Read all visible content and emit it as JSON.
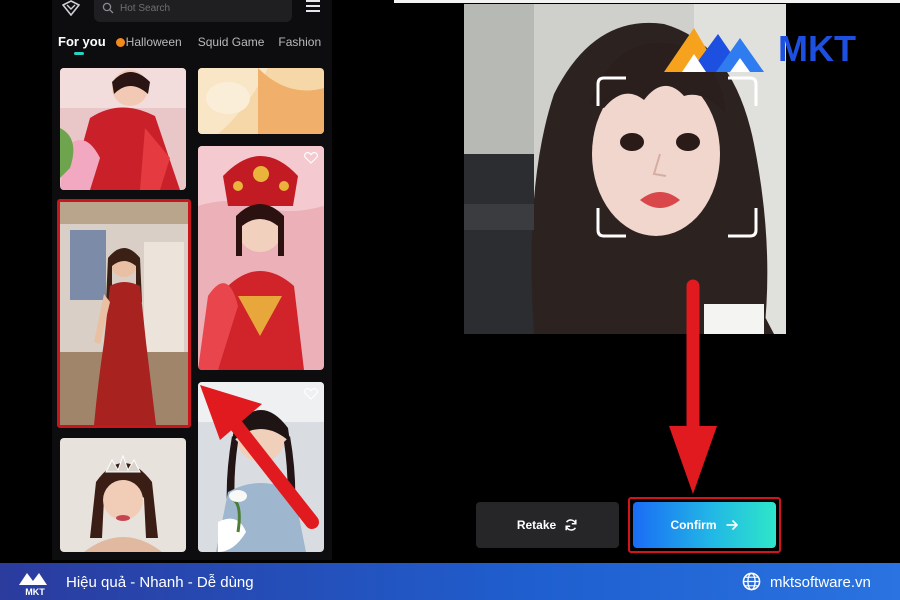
{
  "app": {
    "search_placeholder": "Hot Search",
    "tabs": [
      {
        "label": "For you",
        "active": true
      },
      {
        "label": "Halloween",
        "active": false
      },
      {
        "label": "Squid Game",
        "active": false
      },
      {
        "label": "Fashion",
        "active": false
      }
    ]
  },
  "capture": {
    "retake_label": "Retake",
    "confirm_label": "Confirm"
  },
  "brand": {
    "name": "MKT",
    "footer_logo_text": "MKT",
    "slogan": "Hiệu quả - Nhanh - Dễ dùng",
    "website": "mktsoftware.vn"
  },
  "colors": {
    "accent_tab": "#27d3c2",
    "highlight_red": "#d3141b",
    "confirm_gradient_start": "#1a6cf5",
    "confirm_gradient_end": "#2ee6c9",
    "footer_blue": "#1f5fcf"
  },
  "icons": [
    "app-logo-icon",
    "search-icon",
    "menu-icon",
    "heart-icon",
    "refresh-icon",
    "arrow-right-icon",
    "globe-icon"
  ]
}
